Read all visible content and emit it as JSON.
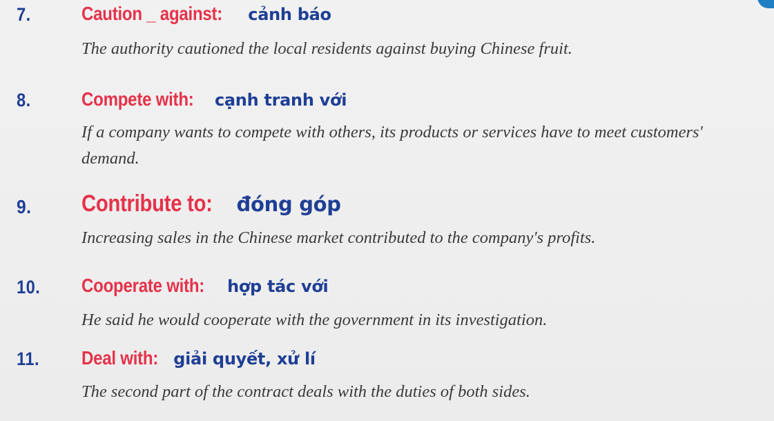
{
  "entries": [
    {
      "number": "7.",
      "term": "Caution _ against:",
      "meaning": "cảnh báo",
      "example": "The authority cautioned the local residents against buying Chinese fruit."
    },
    {
      "number": "8.",
      "term": "Compete with:",
      "meaning": "cạnh tranh với",
      "example": "If a company wants to compete with others, its products or services have to meet customers' demand."
    },
    {
      "number": "9.",
      "term": "Contribute to:",
      "meaning": "đóng góp",
      "example": "Increasing sales in the Chinese market contributed to the company's profits."
    },
    {
      "number": "10.",
      "term": "Cooperate with:",
      "meaning": "hợp tác với",
      "example": "He said he would cooperate with the government in its investigation."
    },
    {
      "number": "11.",
      "term": "Deal with:",
      "meaning": "giải quyết, xử lí",
      "example": "The second part of the contract deals with the duties of both sides."
    }
  ]
}
